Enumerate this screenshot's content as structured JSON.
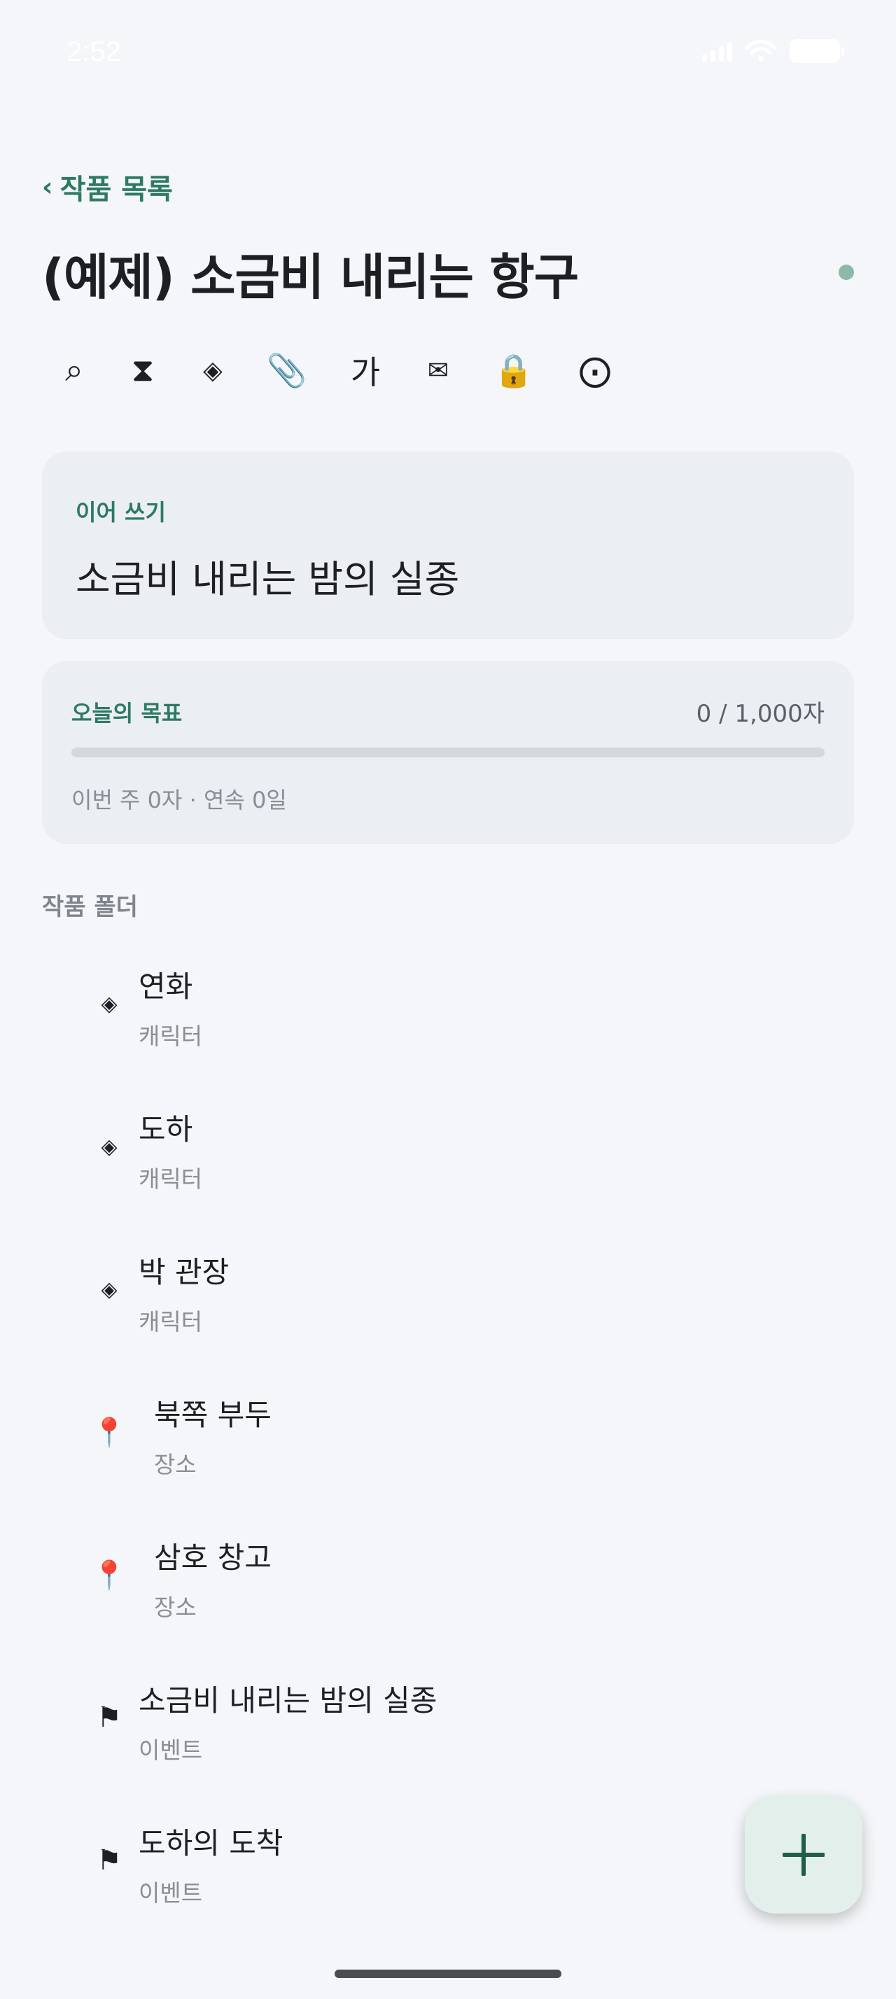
{
  "status_bar": {
    "time": "2:52"
  },
  "header": {
    "back_label": "작품 목록",
    "title": "(예제) 소금비 내리는 항구"
  },
  "toolbar": {
    "items": [
      {
        "icon": "search-icon",
        "glyph": "⌕"
      },
      {
        "icon": "hourglass-icon",
        "glyph": "⧗"
      },
      {
        "icon": "diamond-icon",
        "glyph": "◈"
      },
      {
        "icon": "paperclip-icon",
        "glyph": "📎"
      },
      {
        "icon": "font-icon",
        "glyph": "가"
      },
      {
        "icon": "envelope-icon",
        "glyph": "✉"
      },
      {
        "icon": "lock-icon",
        "glyph": "🔒"
      },
      {
        "icon": "settings-icon",
        "glyph": "⨀"
      }
    ]
  },
  "continue_writing": {
    "label": "이어 쓰기",
    "title": "소금비 내리는 밤의 실종"
  },
  "daily_goal": {
    "label": "오늘의 목표",
    "count": "0 / 1,000자",
    "progress": 0,
    "stats": "이번 주 0자 · 연속 0일"
  },
  "folders": {
    "header": "작품 폴더",
    "items": [
      {
        "name": "연화",
        "type": "캐릭터",
        "icon": "character-icon",
        "glyph": "◈"
      },
      {
        "name": "도하",
        "type": "캐릭터",
        "icon": "character-icon",
        "glyph": "◈"
      },
      {
        "name": "박 관장",
        "type": "캐릭터",
        "icon": "character-icon",
        "glyph": "◈"
      },
      {
        "name": "북쪽 부두",
        "type": "장소",
        "icon": "location-pin-icon",
        "glyph": "📍"
      },
      {
        "name": "삼호 창고",
        "type": "장소",
        "icon": "location-pin-icon",
        "glyph": "📍"
      },
      {
        "name": "소금비 내리는 밤의 실종",
        "type": "이벤트",
        "icon": "flag-icon",
        "glyph": "⚑"
      },
      {
        "name": "도하의 도착",
        "type": "이벤트",
        "icon": "flag-icon",
        "glyph": "⚑"
      }
    ]
  },
  "fab": {
    "icon": "plus-icon"
  },
  "colors": {
    "accent": "#2d7a62",
    "background": "#f4f6f9",
    "card": "#ebeef2"
  }
}
